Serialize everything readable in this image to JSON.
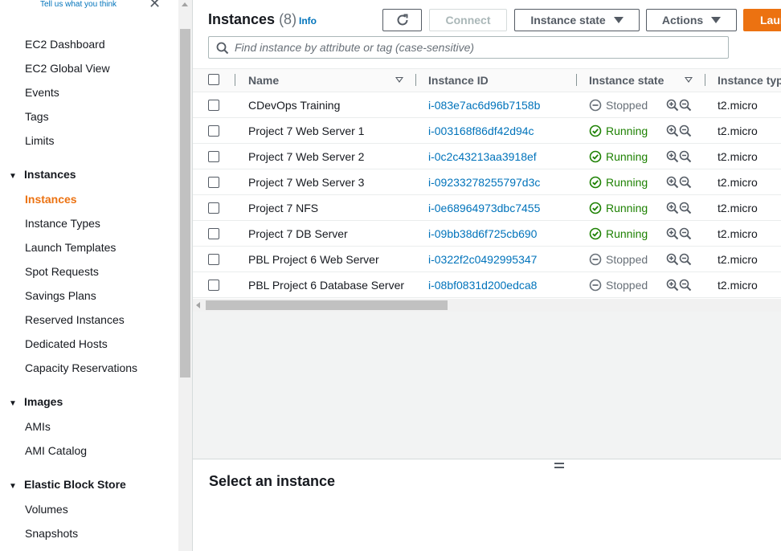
{
  "sidebar": {
    "feedback_link": "Tell us what you think",
    "close_glyph": "✕",
    "top_items": [
      "EC2 Dashboard",
      "EC2 Global View",
      "Events",
      "Tags",
      "Limits"
    ],
    "sections": [
      {
        "label": "Instances",
        "items": [
          "Instances",
          "Instance Types",
          "Launch Templates",
          "Spot Requests",
          "Savings Plans",
          "Reserved Instances",
          "Dedicated Hosts",
          "Capacity Reservations"
        ],
        "active": "Instances"
      },
      {
        "label": "Images",
        "items": [
          "AMIs",
          "AMI Catalog"
        ]
      },
      {
        "label": "Elastic Block Store",
        "items": [
          "Volumes",
          "Snapshots"
        ]
      }
    ]
  },
  "header": {
    "title": "Instances",
    "count": "(8)",
    "info_label": "Info",
    "connect_label": "Connect",
    "instance_state_label": "Instance state",
    "actions_label": "Actions",
    "launch_label": "Laun"
  },
  "search": {
    "placeholder": "Find instance by attribute or tag (case-sensitive)"
  },
  "table": {
    "columns": [
      "Name",
      "Instance ID",
      "Instance state",
      "Instance typ"
    ],
    "rows": [
      {
        "name": "CDevOps Training",
        "id": "i-083e7ac6d96b7158b",
        "state": "Stopped",
        "type": "t2.micro"
      },
      {
        "name": "Project 7 Web Server 1",
        "id": "i-003168f86df42d94c",
        "state": "Running",
        "type": "t2.micro"
      },
      {
        "name": "Project 7 Web Server 2",
        "id": "i-0c2c43213aa3918ef",
        "state": "Running",
        "type": "t2.micro"
      },
      {
        "name": "Project 7 Web Server 3",
        "id": "i-09233278255797d3c",
        "state": "Running",
        "type": "t2.micro"
      },
      {
        "name": "Project 7 NFS",
        "id": "i-0e68964973dbc7455",
        "state": "Running",
        "type": "t2.micro"
      },
      {
        "name": "Project 7 DB Server",
        "id": "i-09bb38d6f725cb690",
        "state": "Running",
        "type": "t2.micro"
      },
      {
        "name": "PBL Project 6 Web Server",
        "id": "i-0322f2c0492995347",
        "state": "Stopped",
        "type": "t2.micro"
      },
      {
        "name": "PBL Project 6 Database Server",
        "id": "i-08bf0831d200edca8",
        "state": "Stopped",
        "type": "t2.micro"
      }
    ]
  },
  "detail": {
    "title": "Select an instance"
  },
  "colors": {
    "accent": "#ec7211",
    "link": "#0073bb",
    "running": "#1d8102",
    "stopped": "#687078"
  }
}
